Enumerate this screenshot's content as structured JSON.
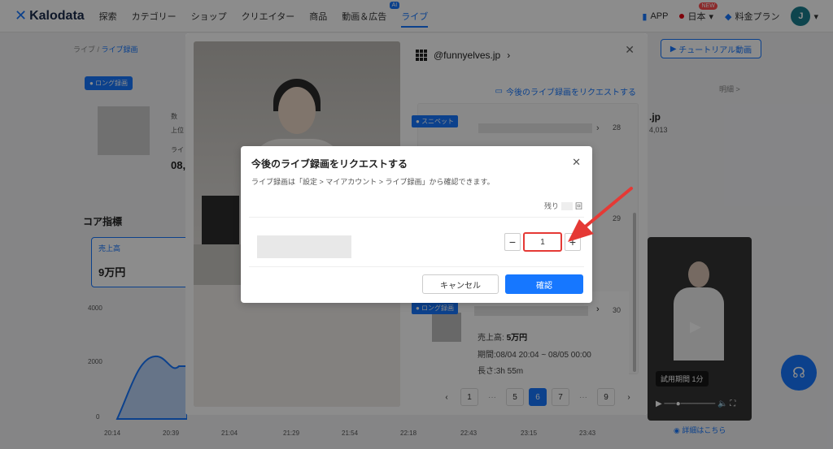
{
  "nav": {
    "logo": "Kalodata",
    "items": [
      "探索",
      "カテゴリー",
      "ショップ",
      "クリエイター",
      "商品",
      "動画＆広告",
      "ライブ"
    ],
    "ai_badge": "AI",
    "app": "APP",
    "lang": "日本",
    "new_badge": "NEW",
    "plan": "料金プラン",
    "avatar": "J"
  },
  "bg": {
    "breadcrumb_root": "ライブ /",
    "breadcrumb_current": "ライブ録画",
    "tutorial": "チュートリアル動画",
    "long_tag": "ロング録画",
    "mini1": "数",
    "mini2": "上位",
    "mini3": "ライ",
    "big1": "08,",
    "core_title": "コア指標",
    "sales_label": "売上高",
    "sales_value": "9万円",
    "y_ticks": [
      "4000",
      "2000",
      "0"
    ],
    "x_ticks": [
      "20:14",
      "20:39",
      "21:04",
      "21:29",
      "21:54",
      "22:18",
      "22:43",
      "23:15",
      "23:43"
    ],
    "detail": "明細 >",
    "jp_name": ".jp",
    "jp_count": "4,013",
    "trial": "試用期間 1分",
    "video_link": "詳細はこちら"
  },
  "modal": {
    "account": "@funnyelves.jp",
    "request_link": "今後のライブ録画をリクエストする",
    "snippet_tag": "スニペット",
    "row_nums": [
      "28",
      "29",
      "30"
    ],
    "long_tag": "ロング録画",
    "item3": {
      "sales_label": "売上高:",
      "sales_value": "5万円",
      "period": "期間:08/04 20:04 ~ 08/05 00:00",
      "length": "長さ:3h 55m"
    },
    "pages": [
      "1",
      "···",
      "5",
      "6",
      "7",
      "···",
      "9"
    ],
    "current_page": "6"
  },
  "dialog": {
    "title": "今後のライブ録画をリクエストする",
    "subtitle": "ライブ録画は「設定 > マイアカウント > ライブ録画」から確認できます。",
    "remain_prefix": "残り",
    "remain_suffix": "回",
    "quantity": "1",
    "cancel": "キャンセル",
    "confirm": "確認"
  },
  "colors": {
    "accent": "#1677ff",
    "highlight": "#e53935"
  }
}
